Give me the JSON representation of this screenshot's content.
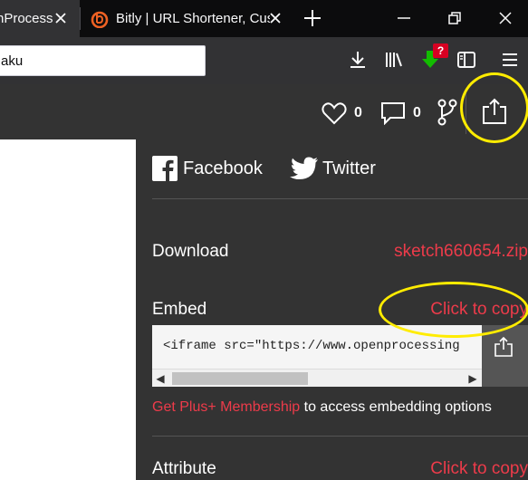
{
  "browser": {
    "tabs": [
      {
        "title": "nProcess",
        "active": true
      },
      {
        "title": "Bitly | URL Shortener, Cus",
        "active": false
      }
    ],
    "url_value": "aku",
    "notification_badge": "?"
  },
  "header": {
    "likes_count": "0",
    "comments_count": "0"
  },
  "share": {
    "social": [
      {
        "label": "Facebook",
        "icon": "facebook-icon"
      },
      {
        "label": "Twitter",
        "icon": "twitter-icon"
      }
    ],
    "download": {
      "label": "Download",
      "file": "sketch660654.zip"
    },
    "embed": {
      "label": "Embed",
      "copy_label": "Click to copy",
      "code": "<iframe src=\"https://www.openprocessing"
    },
    "plus": {
      "link": "Get Plus+ Membership",
      "rest": " to access embedding options"
    },
    "attribute": {
      "label": "Attribute",
      "copy_label": "Click to copy"
    }
  },
  "colors": {
    "accent": "#ed3b4a",
    "panel_bg": "#333333",
    "annotation": "#ffec00",
    "bitly_orange": "#ee6123",
    "download_green": "#12bc00",
    "badge_red": "#d70022"
  }
}
